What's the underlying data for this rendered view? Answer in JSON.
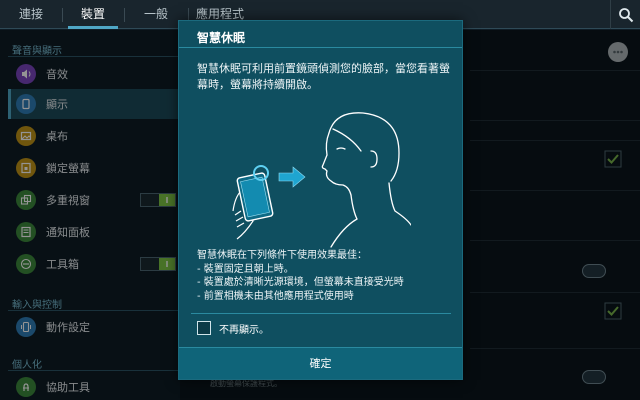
{
  "tabs": [
    {
      "label": "連接"
    },
    {
      "label": "裝置"
    },
    {
      "label": "一般"
    },
    {
      "label": "應用程式"
    }
  ],
  "active_tab": "裝置",
  "accent_color": "#4fa7c6",
  "sections": {
    "sound_display": "聲音與顯示",
    "input_control": "輸入與控制",
    "personal": "個人化"
  },
  "items": [
    {
      "label": "音效",
      "icon": "speaker-icon",
      "color": "#7a46c0"
    },
    {
      "label": "顯示",
      "icon": "display-icon",
      "color": "#2f7fb8"
    },
    {
      "label": "桌布",
      "icon": "wallpaper-icon",
      "color": "#c29418"
    },
    {
      "label": "鎖定螢幕",
      "icon": "lock-icon",
      "color": "#c29418"
    },
    {
      "label": "多重視窗",
      "icon": "multiwindow-icon",
      "color": "#3d8a3d"
    },
    {
      "label": "通知面板",
      "icon": "notification-panel-icon",
      "color": "#3d8a3d"
    },
    {
      "label": "工具箱",
      "icon": "toolbox-icon",
      "color": "#3d8a3d"
    },
    {
      "label": "動作設定",
      "icon": "motion-icon",
      "color": "#2f7fb8"
    },
    {
      "label": "協助工具",
      "icon": "accessibility-icon",
      "color": "#3d8a3d"
    }
  ],
  "dialog": {
    "title": "智慧休眠",
    "intro": "智慧休眠可利用前置鏡頭偵測您的臉部，當您看著螢幕時，螢幕將持續開啟。",
    "conditions_title": "智慧休眠在下列條件下使用效果最佳：",
    "conditions": [
      "- 裝置固定且朝上時。",
      "- 裝置處於清晰光源環境，但螢幕未直接受光時",
      "- 前置相機未由其他應用程式使用時"
    ],
    "dont_show_label": "不再顯示。",
    "ok_label": "確定"
  },
  "right_panel": {
    "screensaver_subtext": "啟動螢幕保護程式。"
  }
}
